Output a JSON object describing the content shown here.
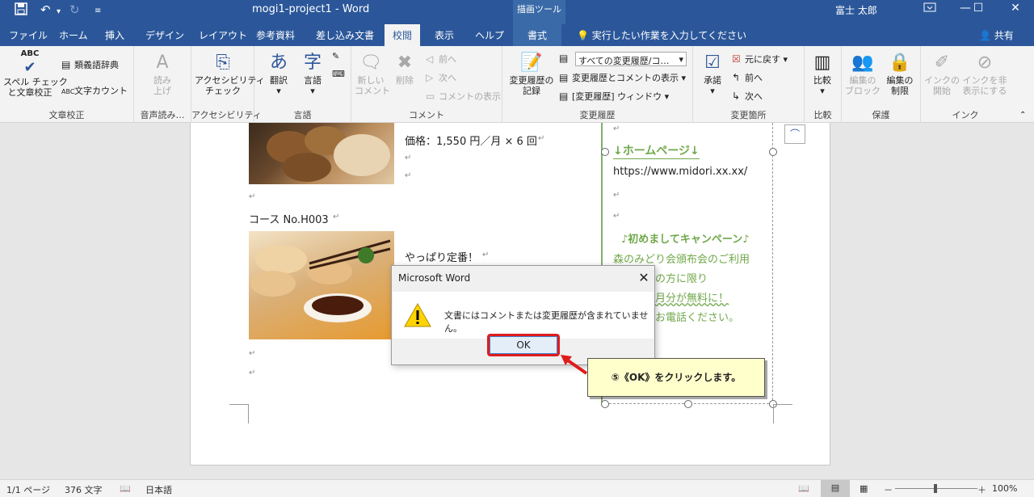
{
  "titlebar": {
    "save_icon": "save-icon",
    "undo_icon": "undo-icon",
    "redo_icon": "redo-icon",
    "customize_icon": "customize-qat-icon",
    "doc_title": "mogi1-project1  -  Word",
    "context_tool": "描画ツール",
    "user_name": "富士 太郎",
    "ribbon_display_icon": "ribbon-display-options-icon",
    "minimize": "—",
    "maximize": "☐",
    "close": "✕"
  },
  "tabs": [
    "ファイル",
    "ホーム",
    "挿入",
    "デザイン",
    "レイアウト",
    "参考資料",
    "差し込み文書",
    "校閲",
    "表示",
    "ヘルプ",
    "書式"
  ],
  "active_tab": "校閲",
  "tell_me": "実行したい作業を入力してください",
  "share": "共有",
  "ribbon": {
    "proofing": {
      "label": "文章校正",
      "spell_abc": "ABC",
      "spell": "スペル チェック\nと文章校正",
      "thesaurus": "類義語辞典",
      "word_count": "文字カウント"
    },
    "speech": {
      "label": "音声読み…",
      "read_aloud": "読み\n上げ"
    },
    "accessibility": {
      "label": "アクセシビリティ",
      "check": "アクセシビリティ\nチェック"
    },
    "language": {
      "label": "言語",
      "translate": "翻訳",
      "language": "言語"
    },
    "comments": {
      "label": "コメント",
      "new": "新しい\nコメント",
      "delete": "削除",
      "prev": "前へ",
      "next": "次へ",
      "show": "コメントの表示"
    },
    "tracking": {
      "label": "変更履歴",
      "track": "変更履歴の\n記録",
      "display_select": "すべての変更履歴/コ…",
      "show_markup": "変更履歴とコメントの表示",
      "pane": "[変更履歴] ウィンドウ"
    },
    "changes": {
      "label": "変更箇所",
      "accept": "承諾",
      "reject": "元に戻す",
      "prev": "前へ",
      "next": "次へ"
    },
    "compare": {
      "label": "比較",
      "compare": "比較"
    },
    "protect": {
      "label": "保護",
      "block": "編集の\nブロック",
      "restrict": "編集の\n制限"
    },
    "ink": {
      "label": "インク",
      "start": "インクの\n開始",
      "hide": "インクを非\n表示にする"
    }
  },
  "document": {
    "price_line": "価格：1,550 円／月 × 6 回",
    "course_label": "コース No.H003",
    "course_desc": "やっぱり定番！",
    "sidebar_heading": "↓ホームページ↓",
    "sidebar_url": "https://www.midori.xx.xx/",
    "campaign_heading": "♪初めましてキャンペーン♪",
    "campaign_line1": "森のみどり会頒布会のご利用",
    "campaign_line2": "の方に限り",
    "campaign_line3": "月分が無料に！",
    "campaign_line4": "お電話ください。",
    "para_mark": "↵"
  },
  "dialog": {
    "title": "Microsoft Word",
    "message": "文書にはコメントまたは変更履歴が含まれていません。",
    "ok": "OK",
    "warning_icon": "warning-icon"
  },
  "callout": {
    "text": "⑤《OK》をクリックします。"
  },
  "statusbar": {
    "page": "1/1 ページ",
    "words": "376 文字",
    "language": "日本語",
    "zoom": "100%",
    "zoom_level": 100
  },
  "colors": {
    "word_blue": "#2b579a",
    "sidebar_green": "#70a84a",
    "ok_highlight": "#e01c1c",
    "callout_bg": "#ffffcc"
  }
}
